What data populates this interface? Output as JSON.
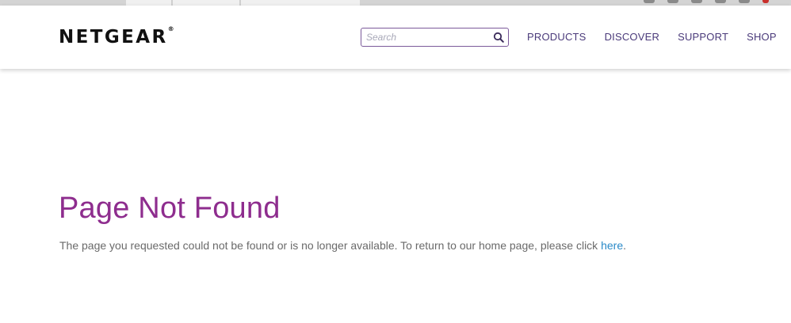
{
  "header": {
    "logo_text": "NETGEAR",
    "logo_mark": "®",
    "search": {
      "placeholder": "Search",
      "value": ""
    },
    "nav": {
      "products": "PRODUCTS",
      "discover": "DISCOVER",
      "support": "SUPPORT",
      "shop": "SHOP"
    }
  },
  "main": {
    "title": "Page Not Found",
    "message_prefix": "The page you requested could not be found or is no longer available. To return to our home page, please click ",
    "link_text": "here",
    "message_suffix": "."
  },
  "colors": {
    "title": "#8e2d8e",
    "nav": "#4a3a7a",
    "link": "#2a8ac8",
    "body_text": "#6a6a6a",
    "search_border": "#7b5a9a"
  },
  "icons": {
    "search": "search-icon",
    "social": [
      "facebook-icon",
      "twitter-icon",
      "youtube-icon",
      "instagram-icon",
      "google-plus-icon",
      "flag-icon"
    ]
  }
}
